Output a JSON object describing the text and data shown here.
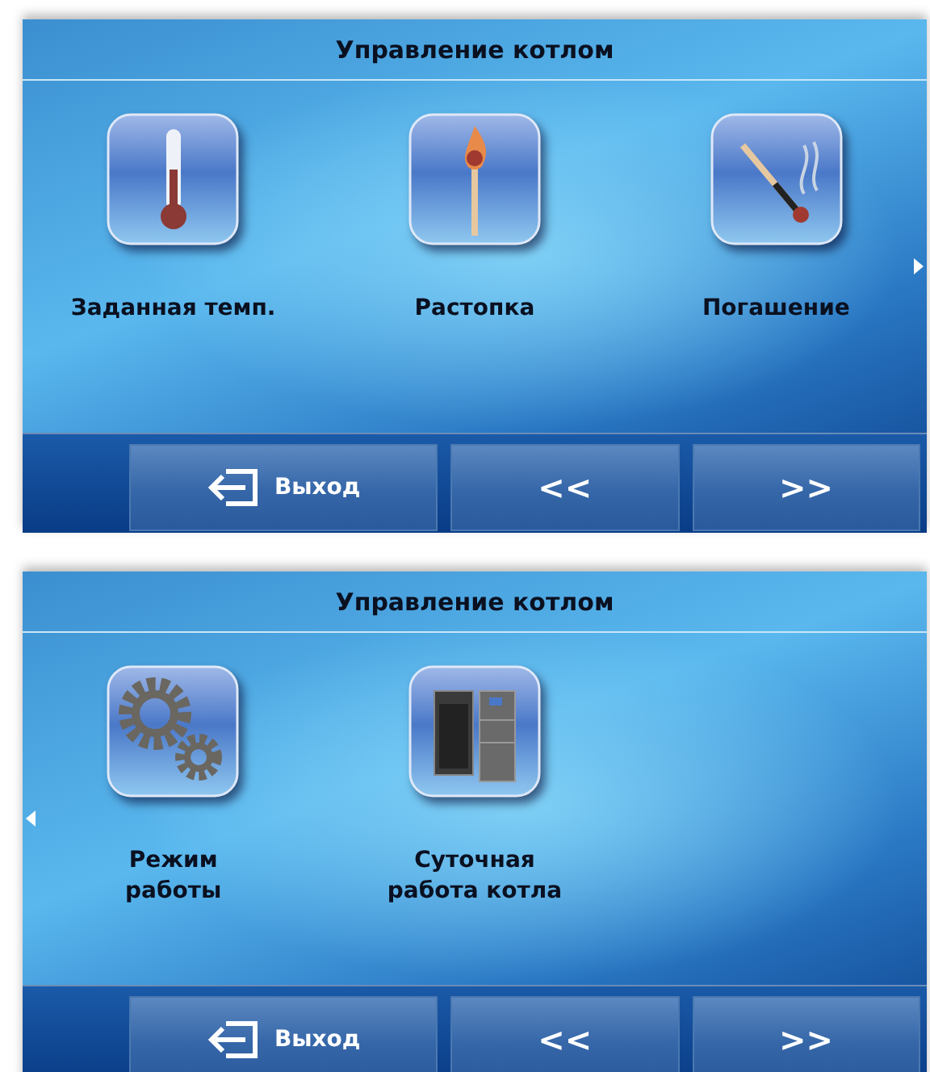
{
  "screens": [
    {
      "title": "Управление котлом",
      "next_page_arrow": true,
      "prev_page_arrow": false,
      "tiles": [
        {
          "kind": "thermometer",
          "label": "Заданная темп."
        },
        {
          "kind": "match",
          "label": "Растопка"
        },
        {
          "kind": "extinguished_match",
          "label": "Погашение"
        }
      ],
      "buttons": [
        {
          "kind": "exit",
          "label": "Выход"
        },
        {
          "kind": "nav",
          "label": "<<"
        },
        {
          "kind": "nav",
          "label": ">>"
        }
      ]
    },
    {
      "title": "Управление котлом",
      "next_page_arrow": false,
      "prev_page_arrow": true,
      "tiles": [
        {
          "kind": "gears",
          "label": "Режим\nработы"
        },
        {
          "kind": "boiler",
          "label": "Суточная\nработа котла"
        }
      ],
      "buttons": [
        {
          "kind": "exit",
          "label": "Выход"
        },
        {
          "kind": "nav",
          "label": "<<"
        },
        {
          "kind": "nav",
          "label": ">>"
        }
      ]
    }
  ]
}
